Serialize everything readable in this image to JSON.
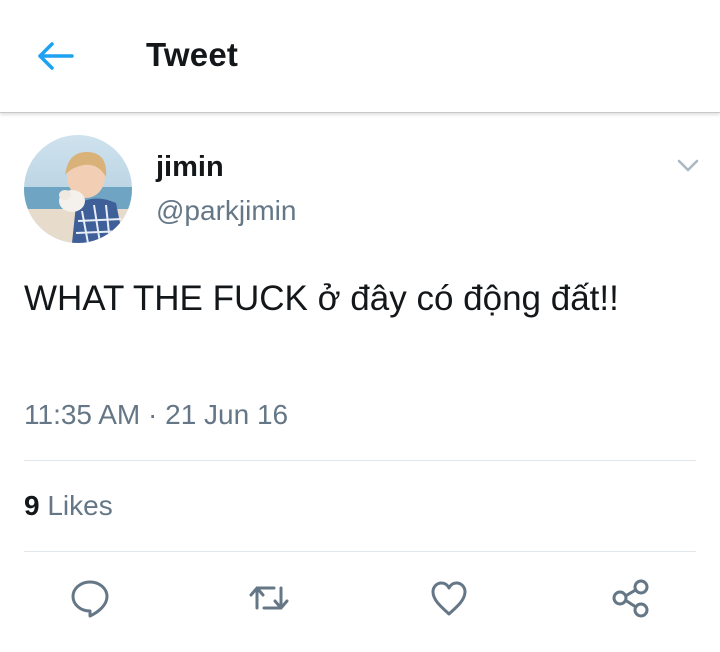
{
  "header": {
    "title": "Tweet"
  },
  "tweet": {
    "display_name": "jimin",
    "handle": "@parkjimin",
    "text": "WHAT THE FUCK ở đây có động đất!!",
    "time": "11:35 AM",
    "separator": "·",
    "date": "21 Jun 16",
    "likes_count": "9",
    "likes_label": "Likes"
  },
  "icons": {
    "back": "arrow-left-icon",
    "more": "chevron-down-icon",
    "reply": "reply-icon",
    "retweet": "retweet-icon",
    "like": "heart-icon",
    "share": "share-icon"
  },
  "colors": {
    "accent": "#1da1f2",
    "text": "#14171a",
    "secondary": "#657786",
    "divider": "#e1e8ed"
  }
}
